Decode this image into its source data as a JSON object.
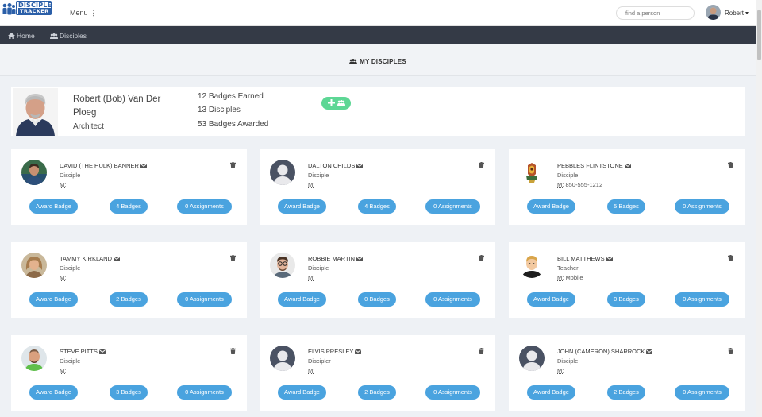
{
  "logo": {
    "line1": "DISCIPLE",
    "line2": "TRACKER"
  },
  "header": {
    "menu_label": "Menu",
    "menu_dots": "⋮",
    "search_placeholder": "find a person",
    "user_name": "Robert"
  },
  "nav": {
    "home": "Home",
    "disciples": "Disciples"
  },
  "section": {
    "title": "MY DISCIPLES"
  },
  "profile": {
    "name": "Robert (Bob) Van Der Ploeg",
    "role": "Architect",
    "badges_earned": "12 Badges Earned",
    "disciples_count": "13 Disciples",
    "badges_awarded": "53 Badges Awarded"
  },
  "labels": {
    "award_badge": "Award Badge",
    "mobile_prefix": "M:"
  },
  "disciples": [
    {
      "name": "DAVID (THE HULK) BANNER",
      "role": "Disciple",
      "phone": "",
      "badges": "4 Badges",
      "assignments": "0 Assignments",
      "avatar": "photo-man-1"
    },
    {
      "name": "DALTON CHILDS",
      "role": "Disciple",
      "phone": "",
      "badges": "4 Badges",
      "assignments": "0 Assignments",
      "avatar": "default-avatar"
    },
    {
      "name": "PEBBLES FLINTSTONE",
      "role": "Disciple",
      "phone": "850-555-1212",
      "badges": "5 Badges",
      "assignments": "0 Assignments",
      "avatar": "crest-avatar"
    },
    {
      "name": "TAMMY KIRKLAND",
      "role": "Disciple",
      "phone": "",
      "badges": "2 Badges",
      "assignments": "0 Assignments",
      "avatar": "photo-woman"
    },
    {
      "name": "ROBBIE MARTIN",
      "role": "Disciple",
      "phone": "",
      "badges": "0 Badges",
      "assignments": "0 Assignments",
      "avatar": "photo-man-glasses"
    },
    {
      "name": "BILL MATTHEWS",
      "role": "Teacher",
      "phone": "Mobile",
      "badges": "0 Badges",
      "assignments": "0 Assignments",
      "avatar": "cartoon-avatar"
    },
    {
      "name": "STEVE PITTS",
      "role": "Disciple",
      "phone": "",
      "badges": "3 Badges",
      "assignments": "0 Assignments",
      "avatar": "photo-man-green"
    },
    {
      "name": "ELVIS PRESLEY",
      "role": "Discipler",
      "phone": "",
      "badges": "2 Badges",
      "assignments": "0 Assignments",
      "avatar": "default-avatar"
    },
    {
      "name": "JOHN (CAMERON) SHARROCK",
      "role": "Disciple",
      "phone": "",
      "badges": "2 Badges",
      "assignments": "0 Assignments",
      "avatar": "default-avatar"
    }
  ],
  "colors": {
    "button_blue": "#4aa3df",
    "add_green": "#5dd795",
    "navbar": "#343a46",
    "logo_blue": "#2b5fa8"
  }
}
